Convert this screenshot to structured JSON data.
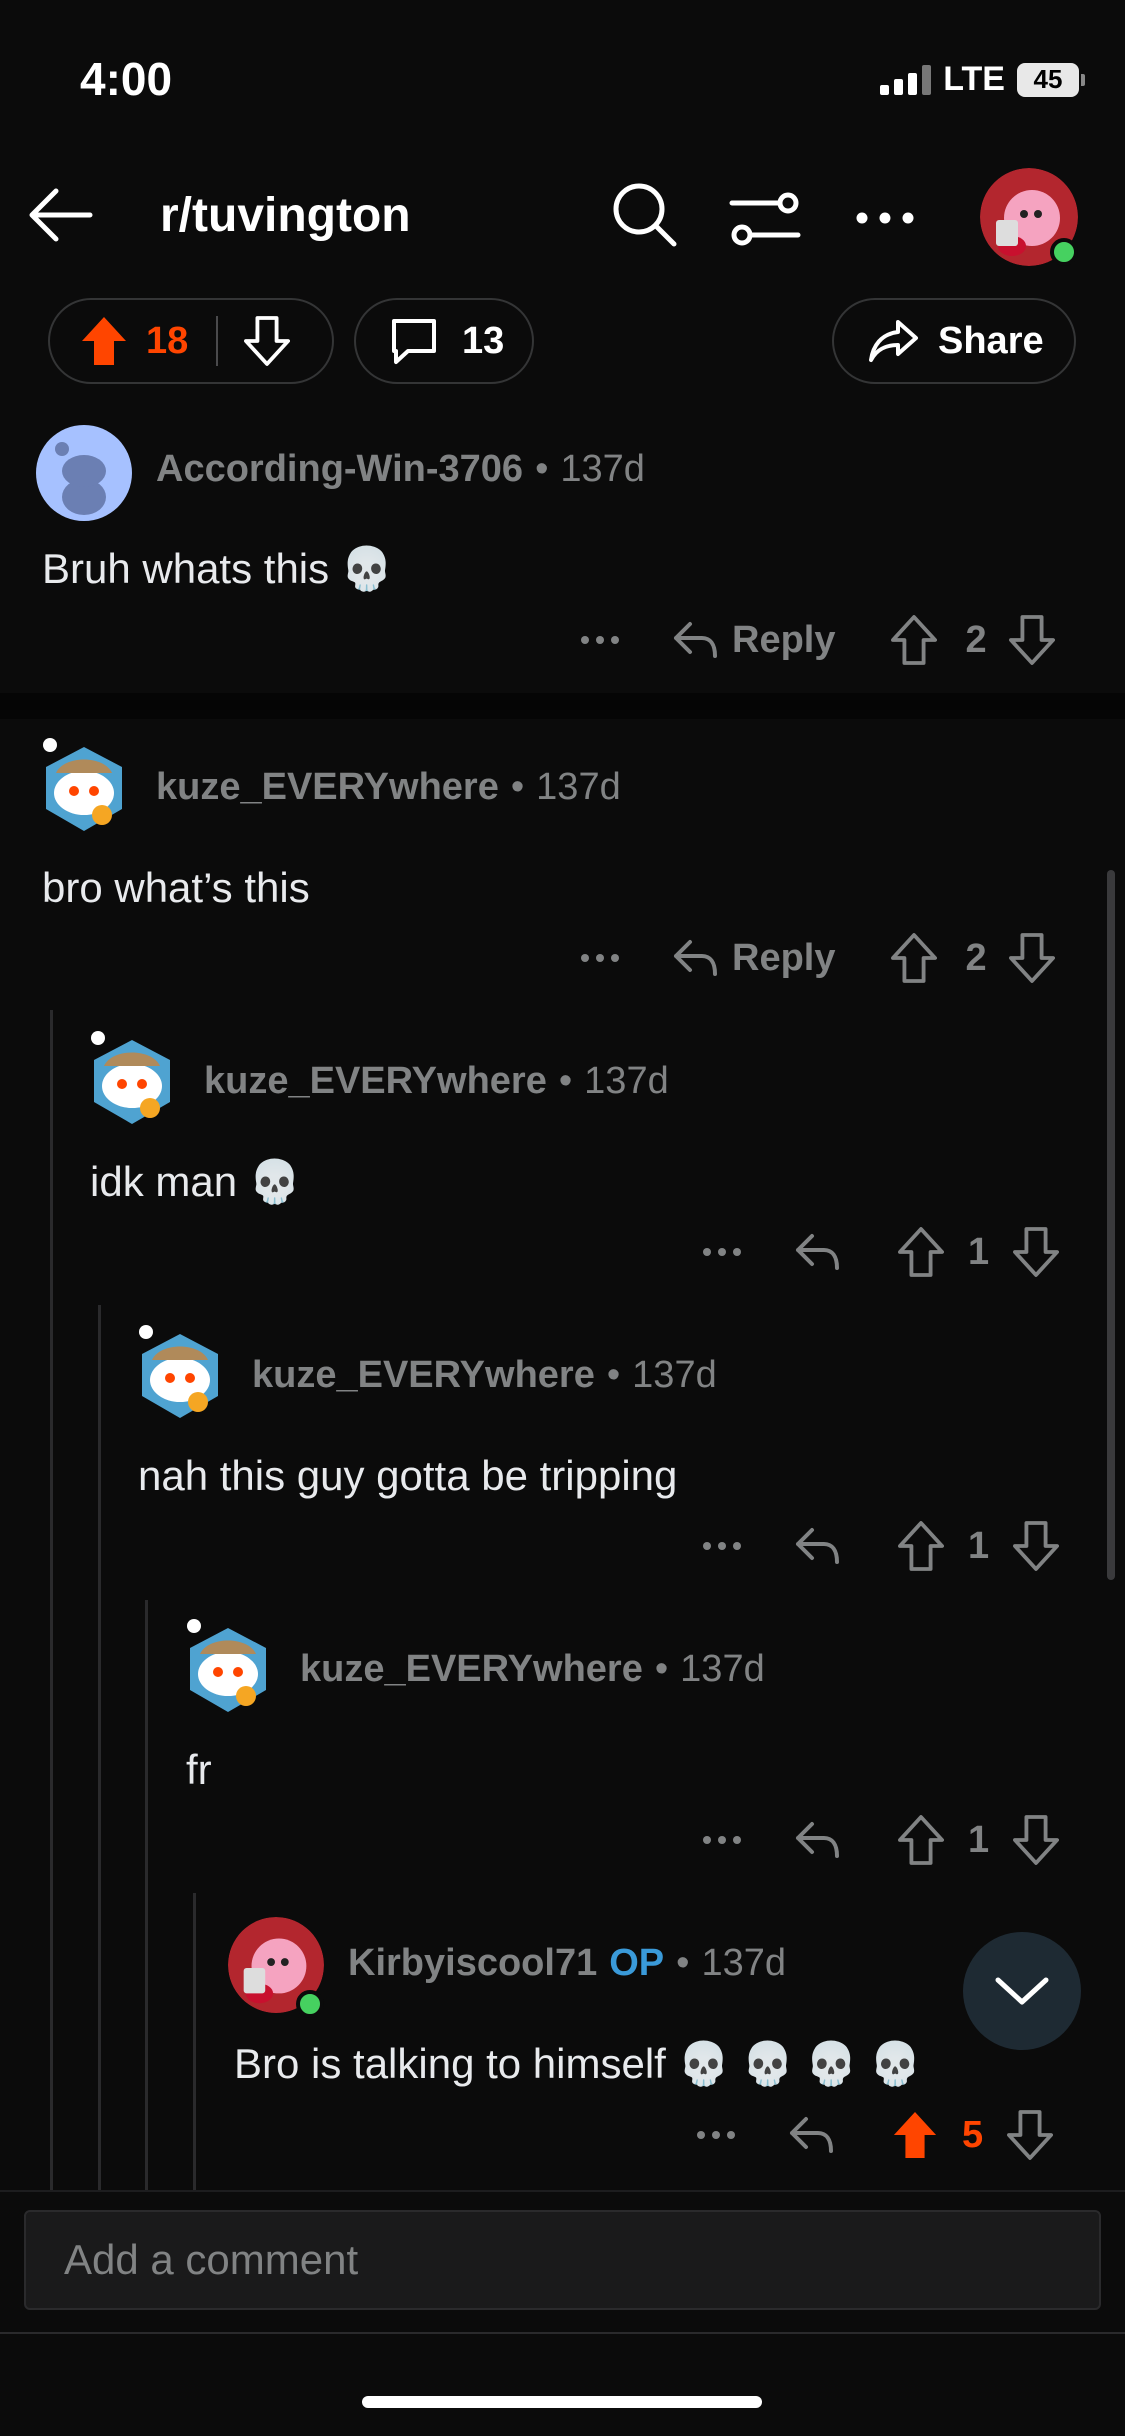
{
  "status": {
    "time": "4:00",
    "network": "LTE",
    "battery": "45"
  },
  "header": {
    "subreddit": "r/tuvington"
  },
  "post_actions": {
    "upvotes": "18",
    "comments": "13",
    "share_label": "Share"
  },
  "comments": [
    {
      "user": "According-Win-3706",
      "age": "137d",
      "text": "Bruh whats this 💀",
      "reply_label": "Reply",
      "score": "2"
    },
    {
      "user": "kuze_EVERYwhere",
      "age": "137d",
      "text": "bro what’s this",
      "reply_label": "Reply",
      "score": "2"
    },
    {
      "user": "kuze_EVERYwhere",
      "age": "137d",
      "text": "idk man 💀",
      "score": "1"
    },
    {
      "user": "kuze_EVERYwhere",
      "age": "137d",
      "text": "nah this guy gotta be tripping",
      "score": "1"
    },
    {
      "user": "kuze_EVERYwhere",
      "age": "137d",
      "text": "fr",
      "score": "1"
    },
    {
      "user": "Kirbyiscool71",
      "op_badge": "OP",
      "age": "137d",
      "text": "Bro is talking to himself 💀 💀 💀 💀",
      "score": "5"
    }
  ],
  "meta_sep": "•",
  "composer": {
    "placeholder": "Add a comment"
  },
  "colors": {
    "upvote_active": "#ff4500",
    "op": "#3a9ad9",
    "online": "#46d160"
  }
}
